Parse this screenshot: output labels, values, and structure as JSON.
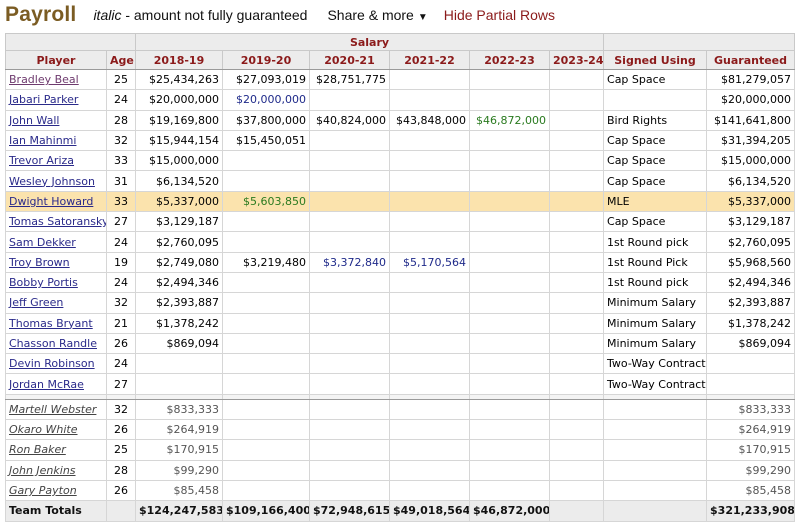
{
  "header": {
    "title": "Payroll",
    "note_italic": "italic",
    "note_rest": " - amount not fully guaranteed",
    "share_label": "Share & more",
    "share_caret": "▼",
    "hide_partial_label": "Hide Partial Rows"
  },
  "table": {
    "group_header": "Salary",
    "columns": [
      "Player",
      "Age",
      "2018-19",
      "2019-20",
      "2020-21",
      "2021-22",
      "2022-23",
      "2023-24",
      "Signed Using",
      "Guaranteed"
    ],
    "rows": [
      {
        "player": "Bradley Beal",
        "visited": true,
        "age": "25",
        "s": [
          "$25,434,263",
          "$27,093,019",
          "$28,751,775",
          "",
          "",
          ""
        ],
        "style": [
          "",
          "",
          "",
          "",
          "",
          ""
        ],
        "signed": "Cap Space",
        "guaranteed": "$81,279,057"
      },
      {
        "player": "Jabari Parker",
        "age": "24",
        "s": [
          "$20,000,000",
          "$20,000,000",
          "",
          "",
          "",
          ""
        ],
        "style": [
          "",
          "player",
          "",
          "",
          "",
          ""
        ],
        "signed": "",
        "guaranteed": "$20,000,000"
      },
      {
        "player": "John Wall",
        "age": "28",
        "s": [
          "$19,169,800",
          "$37,800,000",
          "$40,824,000",
          "$43,848,000",
          "$46,872,000",
          ""
        ],
        "style": [
          "",
          "",
          "",
          "",
          "team",
          ""
        ],
        "signed": "Bird Rights",
        "guaranteed": "$141,641,800"
      },
      {
        "player": "Ian Mahinmi",
        "age": "32",
        "s": [
          "$15,944,154",
          "$15,450,051",
          "",
          "",
          "",
          ""
        ],
        "style": [
          "",
          "",
          "",
          "",
          "",
          ""
        ],
        "signed": "Cap Space",
        "guaranteed": "$31,394,205"
      },
      {
        "player": "Trevor Ariza",
        "age": "33",
        "s": [
          "$15,000,000",
          "",
          "",
          "",
          "",
          ""
        ],
        "style": [
          "",
          "",
          "",
          "",
          "",
          ""
        ],
        "signed": "Cap Space",
        "guaranteed": "$15,000,000"
      },
      {
        "player": "Wesley Johnson",
        "age": "31",
        "s": [
          "$6,134,520",
          "",
          "",
          "",
          "",
          ""
        ],
        "style": [
          "",
          "",
          "",
          "",
          "",
          ""
        ],
        "signed": "Cap Space",
        "guaranteed": "$6,134,520"
      },
      {
        "player": "Dwight Howard",
        "age": "33",
        "highlight": true,
        "s": [
          "$5,337,000",
          "$5,603,850",
          "",
          "",
          "",
          ""
        ],
        "style": [
          "",
          "team",
          "",
          "",
          "",
          ""
        ],
        "signed": "MLE",
        "guaranteed": "$5,337,000"
      },
      {
        "player": "Tomas Satoransky",
        "age": "27",
        "s": [
          "$3,129,187",
          "",
          "",
          "",
          "",
          ""
        ],
        "style": [
          "",
          "",
          "",
          "",
          "",
          ""
        ],
        "signed": "Cap Space",
        "guaranteed": "$3,129,187"
      },
      {
        "player": "Sam Dekker",
        "age": "24",
        "s": [
          "$2,760,095",
          "",
          "",
          "",
          "",
          ""
        ],
        "style": [
          "",
          "",
          "",
          "",
          "",
          ""
        ],
        "signed": "1st Round pick",
        "guaranteed": "$2,760,095"
      },
      {
        "player": "Troy Brown",
        "age": "19",
        "s": [
          "$2,749,080",
          "$3,219,480",
          "$3,372,840",
          "$5,170,564",
          "",
          ""
        ],
        "style": [
          "",
          "",
          "player",
          "player",
          "",
          ""
        ],
        "signed": "1st Round Pick",
        "guaranteed": "$5,968,560"
      },
      {
        "player": "Bobby Portis",
        "age": "24",
        "s": [
          "$2,494,346",
          "",
          "",
          "",
          "",
          ""
        ],
        "style": [
          "",
          "",
          "",
          "",
          "",
          ""
        ],
        "signed": "1st Round pick",
        "guaranteed": "$2,494,346"
      },
      {
        "player": "Jeff Green",
        "age": "32",
        "s": [
          "$2,393,887",
          "",
          "",
          "",
          "",
          ""
        ],
        "style": [
          "",
          "",
          "",
          "",
          "",
          ""
        ],
        "signed": "Minimum Salary",
        "guaranteed": "$2,393,887"
      },
      {
        "player": "Thomas Bryant",
        "age": "21",
        "s": [
          "$1,378,242",
          "",
          "",
          "",
          "",
          ""
        ],
        "style": [
          "",
          "",
          "",
          "",
          "",
          ""
        ],
        "signed": "Minimum Salary",
        "guaranteed": "$1,378,242"
      },
      {
        "player": "Chasson Randle",
        "age": "26",
        "s": [
          "$869,094",
          "",
          "",
          "",
          "",
          ""
        ],
        "style": [
          "",
          "",
          "",
          "",
          "",
          ""
        ],
        "signed": "Minimum Salary",
        "guaranteed": "$869,094"
      },
      {
        "player": "Devin Robinson",
        "age": "24",
        "s": [
          "",
          "",
          "",
          "",
          "",
          ""
        ],
        "style": [
          "",
          "",
          "",
          "",
          "",
          ""
        ],
        "signed": "Two-Way Contract",
        "guaranteed": ""
      },
      {
        "player": "Jordan McRae",
        "age": "27",
        "s": [
          "",
          "",
          "",
          "",
          "",
          ""
        ],
        "style": [
          "",
          "",
          "",
          "",
          "",
          ""
        ],
        "signed": "Two-Way Contract",
        "guaranteed": ""
      }
    ],
    "partial_rows": [
      {
        "player": "Martell Webster",
        "age": "32",
        "s": [
          "$833,333",
          "",
          "",
          "",
          "",
          ""
        ],
        "signed": "",
        "guaranteed": "$833,333"
      },
      {
        "player": "Okaro White",
        "age": "26",
        "s": [
          "$264,919",
          "",
          "",
          "",
          "",
          ""
        ],
        "signed": "",
        "guaranteed": "$264,919"
      },
      {
        "player": "Ron Baker",
        "age": "25",
        "s": [
          "$170,915",
          "",
          "",
          "",
          "",
          ""
        ],
        "signed": "",
        "guaranteed": "$170,915"
      },
      {
        "player": "John Jenkins",
        "age": "28",
        "s": [
          "$99,290",
          "",
          "",
          "",
          "",
          ""
        ],
        "signed": "",
        "guaranteed": "$99,290"
      },
      {
        "player": "Gary Payton",
        "age": "26",
        "s": [
          "$85,458",
          "",
          "",
          "",
          "",
          ""
        ],
        "signed": "",
        "guaranteed": "$85,458"
      }
    ],
    "totals": {
      "label": "Team Totals",
      "age": "",
      "s": [
        "$124,247,583",
        "$109,166,400",
        "$72,948,615",
        "$49,018,564",
        "$46,872,000",
        ""
      ],
      "signed": "",
      "guaranteed": "$321,233,908"
    }
  },
  "colors": {
    "title": "#7b5c23",
    "header_text": "#8b1a1a",
    "link": "#2a2a8a",
    "team_option": "#2a7a1f",
    "player_option": "#1f2a8a",
    "highlight_row": "#fbe3ad"
  }
}
